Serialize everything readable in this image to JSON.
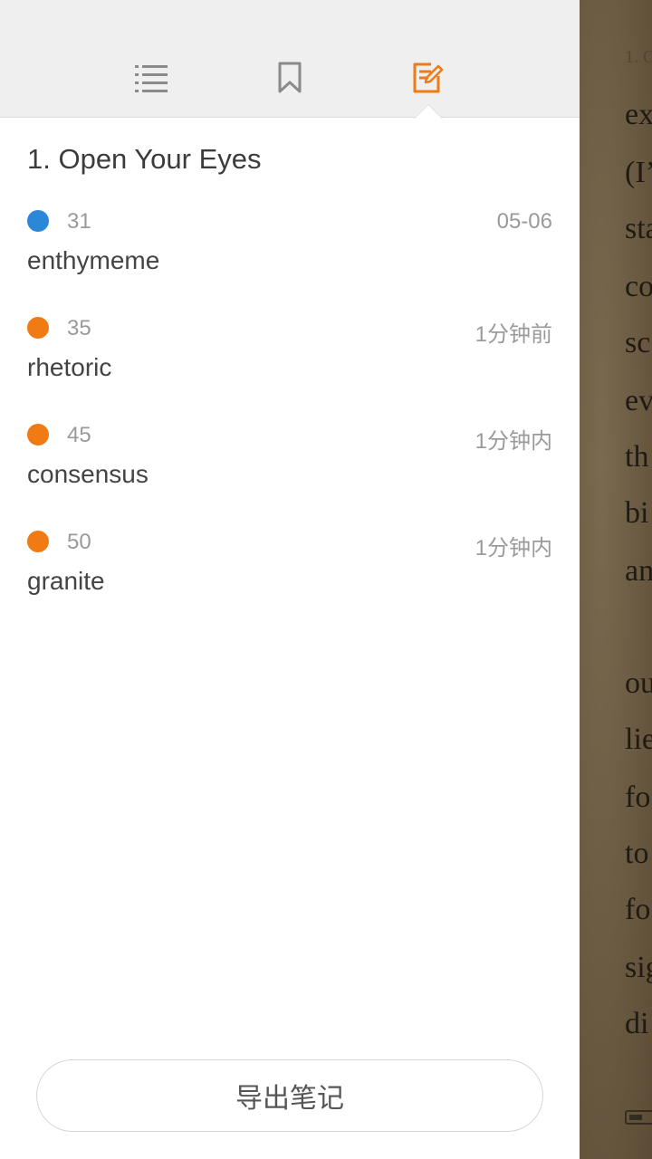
{
  "tabs": [
    {
      "icon": "list-icon",
      "label": "",
      "active": false
    },
    {
      "icon": "bookmark-icon",
      "label": "",
      "active": false
    },
    {
      "icon": "edit-note-icon",
      "label": "",
      "active": true
    }
  ],
  "colors": {
    "accent": "#f07a14",
    "blue_highlight": "#2b88d8",
    "orange_highlight": "#f07a14",
    "inactive_icon": "#8a8a8a"
  },
  "chapter": {
    "title": "1. Open Your Eyes"
  },
  "notes": [
    {
      "page": "31",
      "time": "05-06",
      "text": "enthymeme",
      "color": "#2b88d8"
    },
    {
      "page": "35",
      "time": "1分钟前",
      "text": "rhetoric",
      "color": "#f07a14"
    },
    {
      "page": "45",
      "time": "1分钟内",
      "text": "consensus",
      "color": "#f07a14"
    },
    {
      "page": "50",
      "time": "1分钟内",
      "text": "granite",
      "color": "#f07a14"
    }
  ],
  "export_button": {
    "label": "导出笔记"
  },
  "background_page": {
    "page_marker": "1. O",
    "lines": [
      "ex",
      "(I’",
      "sta",
      "co",
      "sc",
      "ev",
      "th",
      "bi",
      "an",
      "ou",
      "lie",
      "fo",
      "to",
      "fo",
      "sig",
      "di"
    ]
  }
}
